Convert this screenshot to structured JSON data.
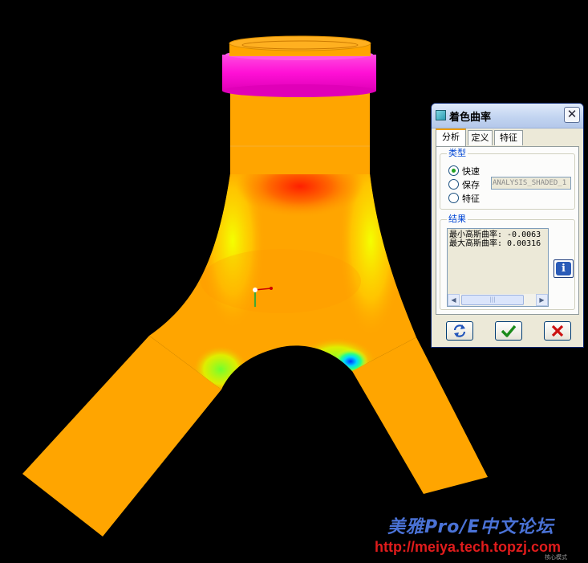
{
  "dialog": {
    "title": "着色曲率",
    "close_icon": "close-icon",
    "tabs": [
      {
        "label": "分析",
        "active": true
      },
      {
        "label": "定义",
        "active": false
      },
      {
        "label": "特征",
        "active": false
      }
    ],
    "type_group": {
      "legend": "类型",
      "options": [
        {
          "label": "快速",
          "selected": true
        },
        {
          "label": "保存",
          "selected": false
        },
        {
          "label": "特征",
          "selected": false
        }
      ],
      "save_name_value": "ANALYSIS_SHADED_1"
    },
    "results_group": {
      "legend": "结果",
      "lines": [
        "最小高斯曲率: -0.0063",
        "最大高斯曲率: 0.00316"
      ]
    },
    "buttons": {
      "repeat_icon": "repeat-icon",
      "ok_icon": "checkmark-icon",
      "cancel_icon": "x-icon",
      "info_icon": "info-icon"
    }
  },
  "watermark": {
    "title": "美雅Pro/E中文论坛",
    "url": "http://meiya.tech.topzj.com",
    "small": "核心模式"
  },
  "colors": {
    "background": "#000000",
    "model_base": "#ffa500",
    "top_ring": "#ff1fd8",
    "curvature_high": "#ff2000",
    "curvature_low": "#0055ff",
    "curvature_mid": "#ffff00"
  }
}
